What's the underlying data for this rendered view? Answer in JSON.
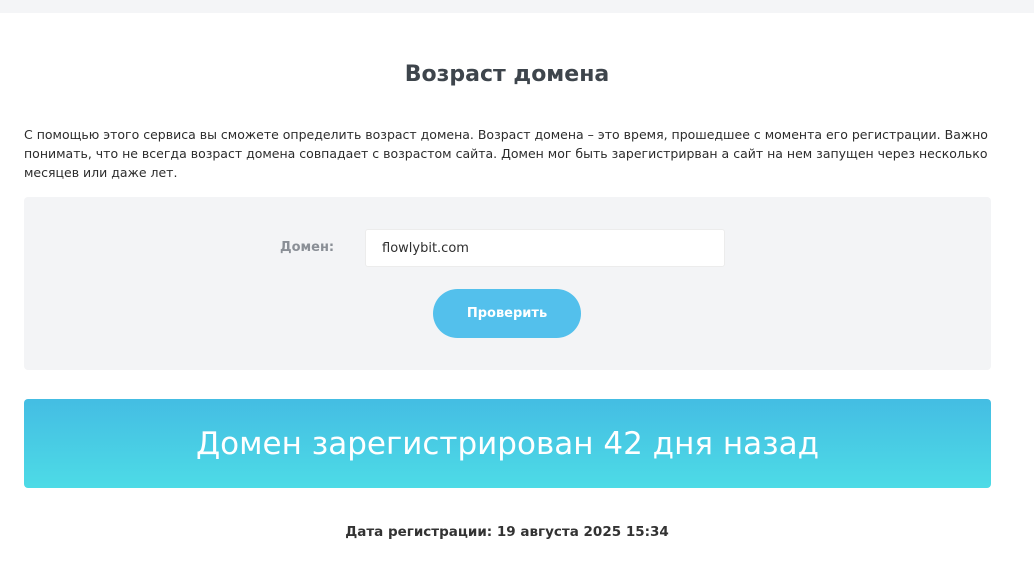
{
  "header": {
    "title": "Возраст домена"
  },
  "intro": {
    "text": "С помощью этого сервиса вы сможете определить возраст домена. Возраст домена – это время, прошедшее с момента его регистрации. Важно понимать, что не всегда возраст домена совпадает с возрастом сайта. Домен мог быть зарегистрирван а сайт на нем запущен через несколько месяцев или даже лет."
  },
  "form": {
    "domain_label": "Домен:",
    "domain_value": "flowlybit.com",
    "submit_label": "Проверить"
  },
  "result": {
    "headline": "Домен зарегистрирован 42 дня назад",
    "registration_date": "Дата регистрации: 19 августа 2025 15:34"
  },
  "colors": {
    "button": "#53c0ec",
    "banner_top": "#44bde3",
    "banner_bottom": "#4ddbe6"
  }
}
